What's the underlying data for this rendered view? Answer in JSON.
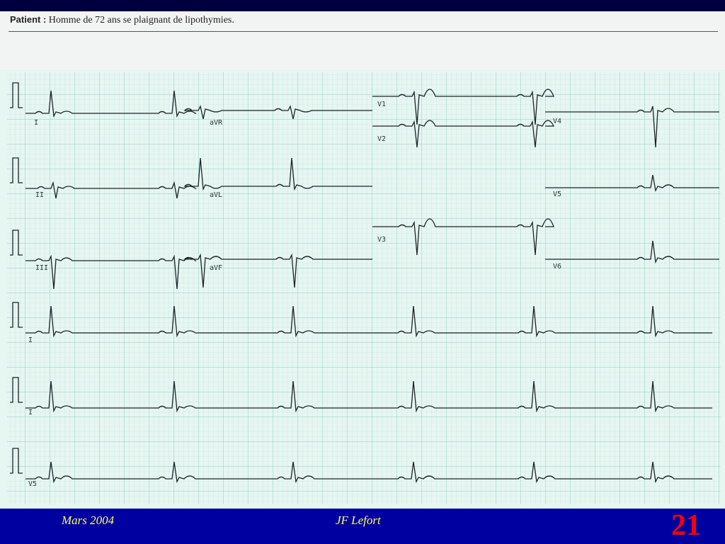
{
  "header": {
    "patient_label": "Patient :",
    "patient_text": "Homme de 72 ans se plaignant de lipothymies."
  },
  "ecg": {
    "row_leads": [
      [
        "I",
        "aVR",
        "V1",
        "V4"
      ],
      [
        "II",
        "aVL",
        "V2",
        "V5"
      ],
      [
        "III",
        "aVF",
        "V3",
        "V6"
      ]
    ],
    "rhythm_strips": [
      "I",
      "I",
      "V5"
    ],
    "colors": {
      "paper": "#e6f6f1",
      "minor_grid": "#bfe3dc",
      "major_grid": "#8fc7c0",
      "trace": "#1c2326"
    }
  },
  "footer": {
    "date": "Mars 2004",
    "author": "JF Lefort",
    "slide_number": "21"
  }
}
